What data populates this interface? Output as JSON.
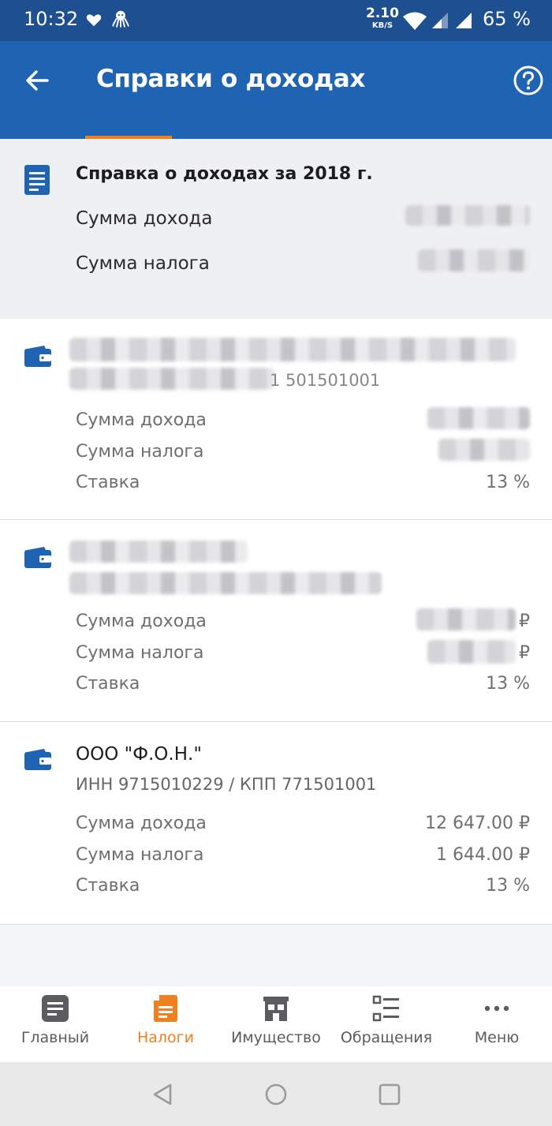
{
  "status_bar": {
    "time": "10:32",
    "speed_value": "2.10",
    "speed_unit": "KB/S",
    "battery": "65 %"
  },
  "app_bar": {
    "title": "Справки о доходах"
  },
  "summary": {
    "title": "Справка о доходах за 2018 г.",
    "income_label": "Сумма дохода",
    "tax_label": "Сумма налога"
  },
  "cards": [
    {
      "inn_visible_fragment": "1 501501001",
      "income_label": "Сумма дохода",
      "tax_label": "Сумма налога",
      "rate_label": "Ставка",
      "rate_value": "13 %"
    },
    {
      "income_label": "Сумма дохода",
      "income_value_fragment": "₽",
      "tax_label": "Сумма налога",
      "tax_value_fragment": "₽",
      "rate_label": "Ставка",
      "rate_value": "13 %"
    },
    {
      "org_name": "ООО \"Ф.О.Н.\"",
      "inn_kpp": "ИНН 9715010229 / КПП 771501001",
      "income_label": "Сумма дохода",
      "income_value": "12 647.00 ₽",
      "tax_label": "Сумма налога",
      "tax_value": "1 644.00 ₽",
      "rate_label": "Ставка",
      "rate_value": "13 %"
    }
  ],
  "bottom_nav": {
    "items": [
      {
        "label": "Главный",
        "icon": "home-doc-icon"
      },
      {
        "label": "Налоги",
        "icon": "tax-doc-icon"
      },
      {
        "label": "Имущество",
        "icon": "property-icon"
      },
      {
        "label": "Обращения",
        "icon": "requests-list-icon"
      },
      {
        "label": "Меню",
        "icon": "more-dots-icon"
      }
    ],
    "active_index": 1
  },
  "colors": {
    "status_bar": "#1d4f91",
    "app_bar": "#1f63b3",
    "accent": "#f07f1d",
    "icon_blue": "#1f63b3"
  }
}
